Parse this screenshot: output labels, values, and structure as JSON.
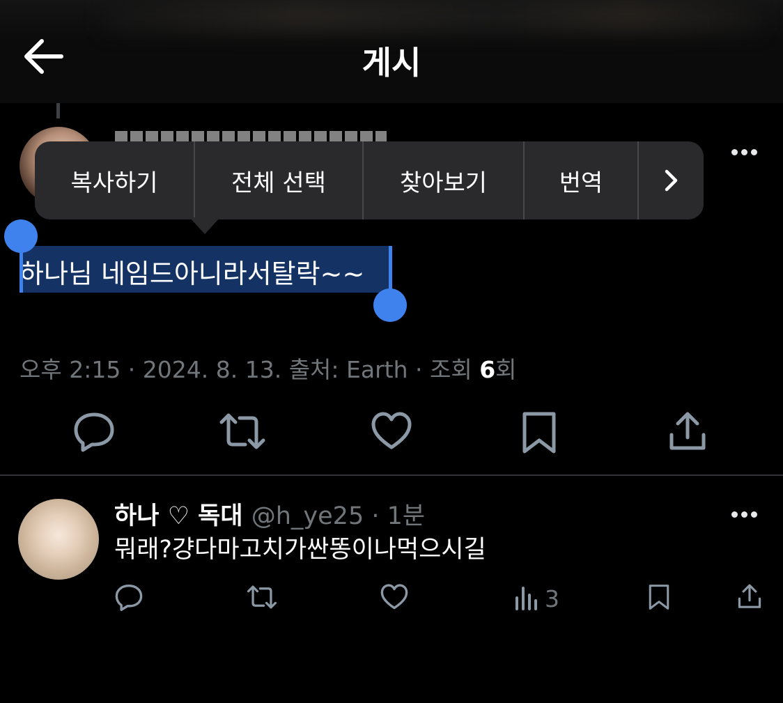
{
  "header": {
    "title": "게시"
  },
  "menu": {
    "items": [
      "복사하기",
      "전체 선택",
      "찾아보기",
      "번역"
    ],
    "more": "›"
  },
  "post": {
    "selected_text": "하나님 네임드아니라서탈락~~",
    "meta_prefix": "오후 2:15 · 2024. 8. 13. 출처: Earth · 조회 ",
    "views": "6",
    "meta_suffix": "회"
  },
  "reply": {
    "name": "하나 ♡ 독대",
    "handle": "@h_ye25 · 1분",
    "text": "뭐래?걍다마고치가싼똥이나먹으시길",
    "views": "3"
  },
  "colors": {
    "accent": "#3f82ee",
    "selection": "#143364",
    "muted": "#71767b"
  }
}
